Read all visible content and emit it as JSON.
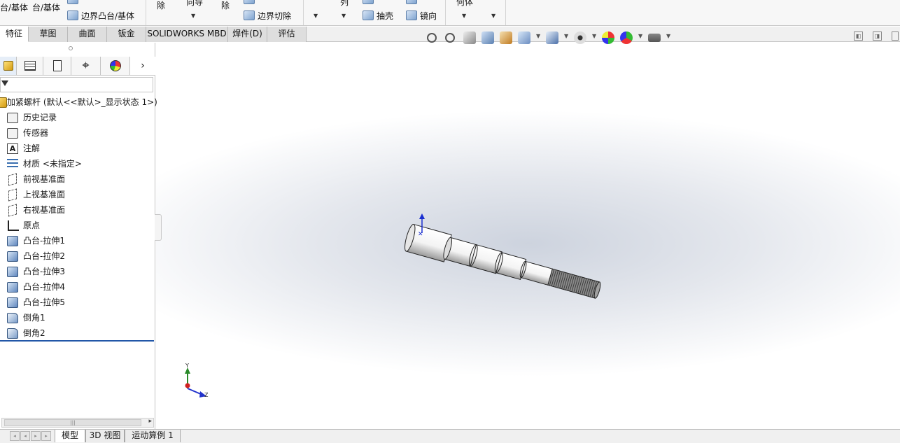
{
  "ribbon": {
    "col1_top": "台/基体",
    "col2_top": "台/基体",
    "boundary_boss": "边界凸台/基体",
    "partial_1": "除",
    "partial_2": "向导",
    "partial_3": "除",
    "boundary_cut": "边界切除",
    "partial_4": "列",
    "shell": "抽壳",
    "mirror": "镜向",
    "partial_5": "何体"
  },
  "command_tabs": [
    {
      "label": "特征",
      "active": true
    },
    {
      "label": "草图"
    },
    {
      "label": "曲面"
    },
    {
      "label": "钣金"
    },
    {
      "label": "SOLIDWORKS MBD"
    },
    {
      "label": "焊件(D)"
    },
    {
      "label": "评估"
    }
  ],
  "feature_tree": {
    "root": "加紧螺杆 (默认<<默认>_显示状态 1>)",
    "items": [
      {
        "label": "历史记录",
        "icon": "history-icon"
      },
      {
        "label": "传感器",
        "icon": "sensor-icon"
      },
      {
        "label": "注解",
        "icon": "annotation-icon"
      },
      {
        "label": "材质 <未指定>",
        "icon": "material-icon"
      },
      {
        "label": "前视基准面",
        "icon": "plane-icon"
      },
      {
        "label": "上视基准面",
        "icon": "plane-icon"
      },
      {
        "label": "右视基准面",
        "icon": "plane-icon"
      },
      {
        "label": "原点",
        "icon": "origin-icon"
      },
      {
        "label": "凸台-拉伸1",
        "icon": "extrude-icon"
      },
      {
        "label": "凸台-拉伸2",
        "icon": "extrude-icon"
      },
      {
        "label": "凸台-拉伸3",
        "icon": "extrude-icon"
      },
      {
        "label": "凸台-拉伸4",
        "icon": "extrude-icon"
      },
      {
        "label": "凸台-拉伸5",
        "icon": "extrude-icon"
      },
      {
        "label": "倒角1",
        "icon": "chamfer-icon"
      },
      {
        "label": "倒角2",
        "icon": "chamfer-icon"
      }
    ]
  },
  "bottom_tabs": [
    {
      "label": "模型",
      "active": true
    },
    {
      "label": "3D 视图"
    },
    {
      "label": "运动算例 1"
    }
  ],
  "triad": {
    "x": "X",
    "y": "Y",
    "z": "Z"
  },
  "colors": {
    "accent": "#2257a8",
    "viewport_center": "#cdd3de"
  }
}
